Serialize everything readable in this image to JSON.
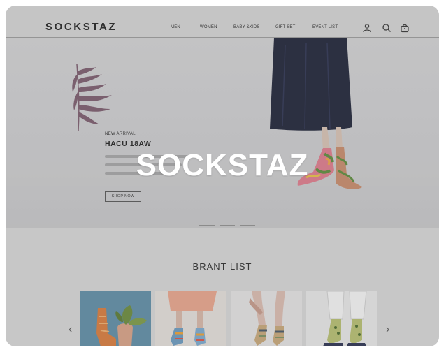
{
  "header": {
    "logo": "SOCKSTAZ",
    "nav": [
      "MEN",
      "WOMEN",
      "BABY &KIDS",
      "GIFT SET",
      "EVENT LIST"
    ],
    "icons": [
      "user-icon",
      "search-icon",
      "bag-icon"
    ]
  },
  "hero": {
    "arrival": "NEW ARRIVAL",
    "collection": "HACU 18AW",
    "shop_button": "SHOP NOW",
    "overlay_brand": "SOCKSTAZ",
    "slides": 3
  },
  "brand_list": {
    "title": "BRANT LIST",
    "prev_arrow": "‹",
    "next_arrow": "›"
  },
  "colors": {
    "overlay_text": "#ffffff",
    "skirt": "#1c2035",
    "leaf": "#7a5a6c"
  }
}
